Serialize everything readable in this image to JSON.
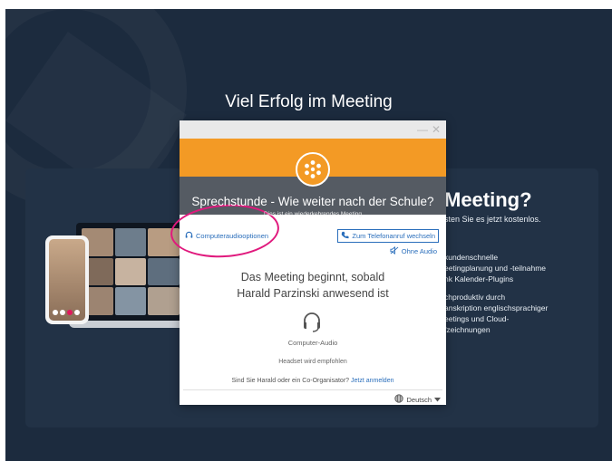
{
  "page": {
    "hero_title": "Viel Erfolg im Meeting"
  },
  "promo": {
    "title": "Meeting?",
    "subtitle": "sten Sie es jetzt kostenlos.",
    "features": [
      [
        "kundenschnelle",
        "eetingplanung und -teilnahme",
        "nk Kalender-Plugins"
      ],
      [
        "chproduktiv durch",
        "anskription englischsprachiger",
        "eetings und Cloud-",
        "fzeichnungen"
      ]
    ]
  },
  "dialog": {
    "minimize_glyph": "—",
    "close_glyph": "✕",
    "meeting_title": "Sprechstunde - Wie weiter nach der Schule?",
    "meeting_subtitle": "Dies ist ein wiederkehrendes Meeting",
    "audio_options_label": "Computeraudiooptionen",
    "switch_phone_label": "Zum Telefonanruf wechseln",
    "no_audio_label": "Ohne Audio",
    "waiting_line1": "Das Meeting beginnt, sobald",
    "waiting_line2": "Harald Parzinski anwesend ist",
    "audio_label": "Computer-Audio",
    "headset_recommendation": "Headset wird empfohlen",
    "organizer_question": "Sind Sie Harald oder ein Co-Organisator?",
    "sign_in_link": "Jetzt anmelden",
    "language": "Deutsch"
  },
  "colors": {
    "background": "#1c2b3e",
    "panel": "#223246",
    "header_orange": "#f39a25",
    "header_band": "#555b63",
    "link_blue": "#2a6ebb",
    "highlight": "#e0197d"
  },
  "icons": {
    "logo": "asterisk-logo-icon",
    "headset": "headset-icon",
    "phone": "phone-icon",
    "no_audio": "muted-speaker-icon",
    "globe": "globe-icon",
    "dropdown": "caret-down-icon"
  }
}
